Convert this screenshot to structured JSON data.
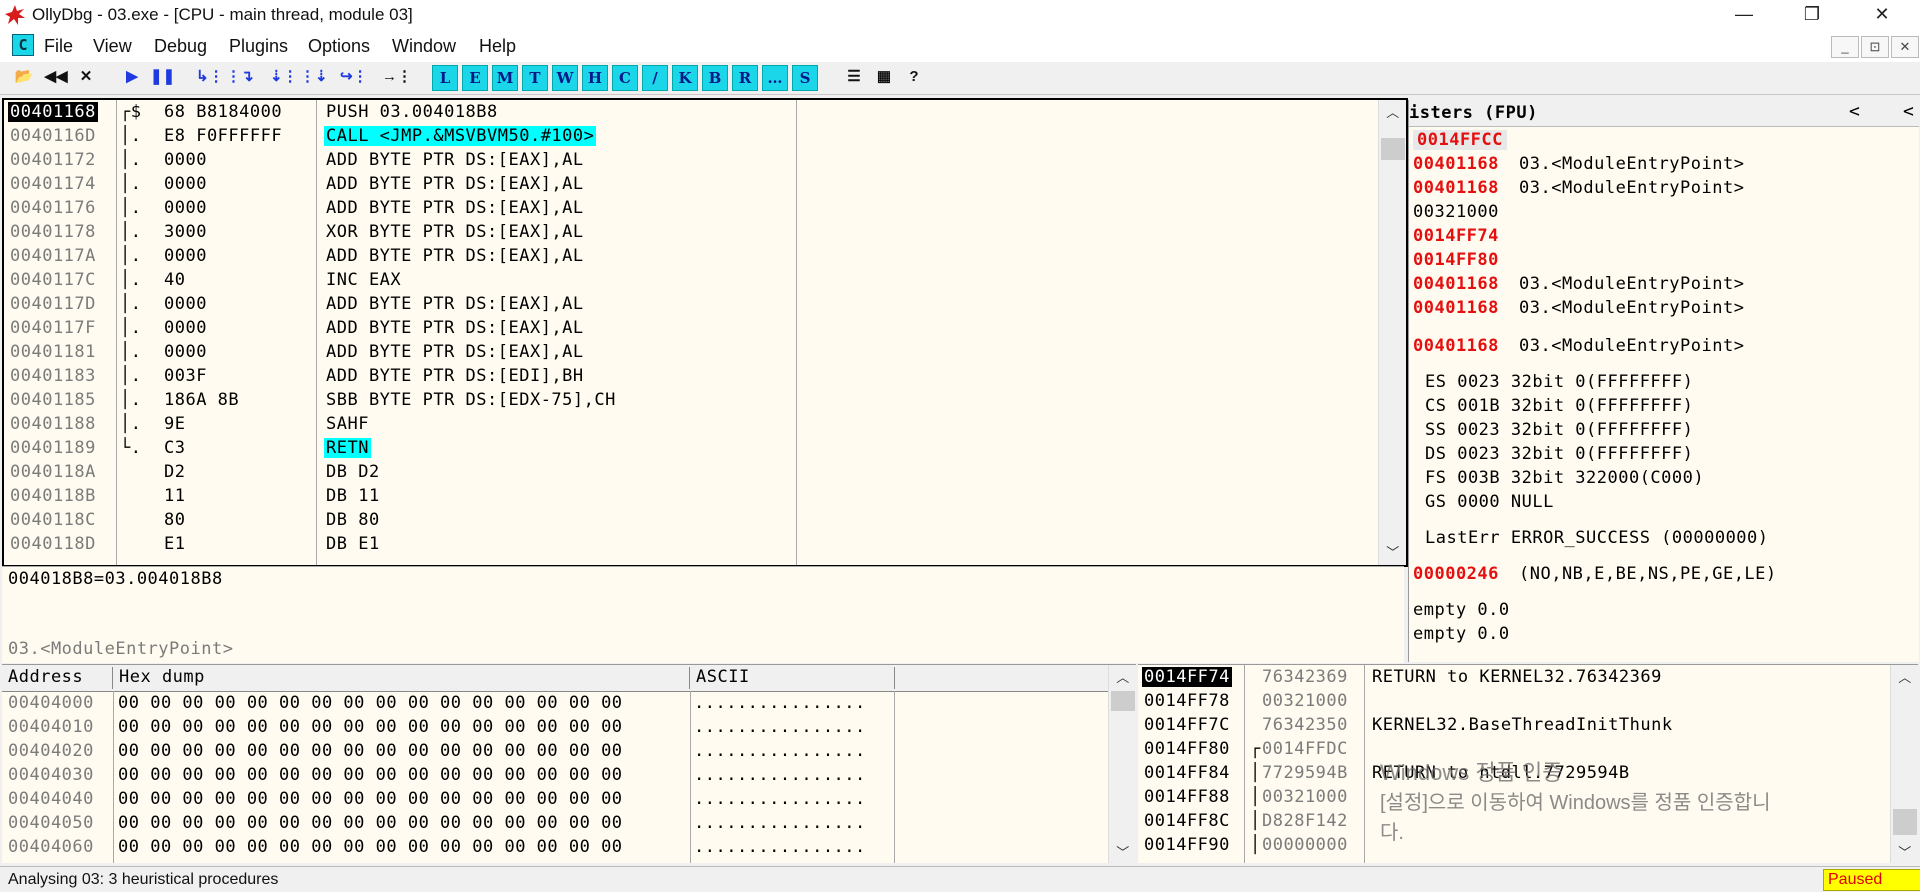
{
  "window": {
    "title": "OllyDbg - 03.exe - [CPU - main thread, module 03]",
    "controls": [
      "—",
      "❐",
      "✕"
    ]
  },
  "menu": {
    "sys_icon": "C",
    "items": [
      "File",
      "View",
      "Debug",
      "Plugins",
      "Options",
      "Window",
      "Help"
    ],
    "mdi_controls": [
      "_",
      "⊡",
      "✕"
    ]
  },
  "toolbar": {
    "buttons": [
      {
        "icon": "open-folder-icon",
        "glyph": "📂",
        "style": "dark"
      },
      {
        "icon": "rewind-icon",
        "glyph": "◀◀",
        "style": "dark"
      },
      {
        "icon": "close-icon",
        "glyph": "✕",
        "style": "dark"
      },
      {
        "icon": "run-icon",
        "glyph": "▶",
        "style": "blue"
      },
      {
        "icon": "pause-icon",
        "glyph": "❚❚",
        "style": "blue"
      },
      {
        "icon": "step-into-icon",
        "glyph": "↳⋮",
        "style": "blue"
      },
      {
        "icon": "step-over-icon",
        "glyph": "⋮↴",
        "style": "blue"
      },
      {
        "icon": "trace-into-icon",
        "glyph": "⇣⋮",
        "style": "blue"
      },
      {
        "icon": "trace-over-icon",
        "glyph": "⋮⇣",
        "style": "blue"
      },
      {
        "icon": "execute-till-return-icon",
        "glyph": "↪⋮",
        "style": "blue"
      },
      {
        "icon": "goto-icon",
        "glyph": "→⋮",
        "style": "dark"
      },
      {
        "icon": "log-window-icon",
        "glyph": "L",
        "style": "letter"
      },
      {
        "icon": "executable-modules-icon",
        "glyph": "E",
        "style": "letter"
      },
      {
        "icon": "memory-map-icon",
        "glyph": "M",
        "style": "letter"
      },
      {
        "icon": "threads-icon",
        "glyph": "T",
        "style": "letter"
      },
      {
        "icon": "windows-icon",
        "glyph": "W",
        "style": "letter"
      },
      {
        "icon": "handles-icon",
        "glyph": "H",
        "style": "letter"
      },
      {
        "icon": "cpu-icon",
        "glyph": "C",
        "style": "letter"
      },
      {
        "icon": "patches-icon",
        "glyph": "/",
        "style": "letter"
      },
      {
        "icon": "call-stack-icon",
        "glyph": "K",
        "style": "letter"
      },
      {
        "icon": "breakpoints-icon",
        "glyph": "B",
        "style": "letter"
      },
      {
        "icon": "references-icon",
        "glyph": "R",
        "style": "letter"
      },
      {
        "icon": "run-trace-icon",
        "glyph": "…",
        "style": "letter"
      },
      {
        "icon": "source-icon",
        "glyph": "S",
        "style": "letter"
      },
      {
        "icon": "list-icon",
        "glyph": "☰",
        "style": "dark"
      },
      {
        "icon": "appearance-icon",
        "glyph": "▦",
        "style": "dark"
      },
      {
        "icon": "help-icon",
        "glyph": "?",
        "style": "dark"
      }
    ]
  },
  "disasm": {
    "rows": [
      {
        "addr": "00401168",
        "brk": "┌$",
        "hex": "68 B8184000",
        "asm": "PUSH 03.004018B8",
        "selected": true,
        "hl": false
      },
      {
        "addr": "0040116D",
        "brk": "│.",
        "hex": "E8 F0FFFFFF",
        "asm": "CALL <JMP.&MSVBVM50.#100>",
        "selected": false,
        "hl": true
      },
      {
        "addr": "00401172",
        "brk": "│.",
        "hex": "0000",
        "asm": "ADD BYTE PTR DS:[EAX],AL",
        "selected": false,
        "hl": false
      },
      {
        "addr": "00401174",
        "brk": "│.",
        "hex": "0000",
        "asm": "ADD BYTE PTR DS:[EAX],AL",
        "selected": false,
        "hl": false
      },
      {
        "addr": "00401176",
        "brk": "│.",
        "hex": "0000",
        "asm": "ADD BYTE PTR DS:[EAX],AL",
        "selected": false,
        "hl": false
      },
      {
        "addr": "00401178",
        "brk": "│.",
        "hex": "3000",
        "asm": "XOR BYTE PTR DS:[EAX],AL",
        "selected": false,
        "hl": false
      },
      {
        "addr": "0040117A",
        "brk": "│.",
        "hex": "0000",
        "asm": "ADD BYTE PTR DS:[EAX],AL",
        "selected": false,
        "hl": false
      },
      {
        "addr": "0040117C",
        "brk": "│.",
        "hex": "40",
        "asm": "INC EAX",
        "selected": false,
        "hl": false
      },
      {
        "addr": "0040117D",
        "brk": "│.",
        "hex": "0000",
        "asm": "ADD BYTE PTR DS:[EAX],AL",
        "selected": false,
        "hl": false
      },
      {
        "addr": "0040117F",
        "brk": "│.",
        "hex": "0000",
        "asm": "ADD BYTE PTR DS:[EAX],AL",
        "selected": false,
        "hl": false
      },
      {
        "addr": "00401181",
        "brk": "│.",
        "hex": "0000",
        "asm": "ADD BYTE PTR DS:[EAX],AL",
        "selected": false,
        "hl": false
      },
      {
        "addr": "00401183",
        "brk": "│.",
        "hex": "003F",
        "asm": "ADD BYTE PTR DS:[EDI],BH",
        "selected": false,
        "hl": false
      },
      {
        "addr": "00401185",
        "brk": "│.",
        "hex": "186A 8B",
        "asm": "SBB BYTE PTR DS:[EDX-75],CH",
        "selected": false,
        "hl": false
      },
      {
        "addr": "00401188",
        "brk": "│.",
        "hex": "9E",
        "asm": "SAHF",
        "selected": false,
        "hl": false
      },
      {
        "addr": "00401189",
        "brk": "└.",
        "hex": "C3",
        "asm": "RETN",
        "selected": false,
        "hl": true
      },
      {
        "addr": "0040118A",
        "brk": "",
        "hex": "D2",
        "asm": "DB D2",
        "selected": false,
        "hl": false
      },
      {
        "addr": "0040118B",
        "brk": "",
        "hex": "11",
        "asm": "DB 11",
        "selected": false,
        "hl": false
      },
      {
        "addr": "0040118C",
        "brk": "",
        "hex": "80",
        "asm": "DB 80",
        "selected": false,
        "hl": false
      },
      {
        "addr": "0040118D",
        "brk": "",
        "hex": "E1",
        "asm": "DB E1",
        "selected": false,
        "hl": false
      }
    ]
  },
  "info": {
    "line1": "004018B8=03.004018B8",
    "line2": "03.<ModuleEntryPoint>"
  },
  "registers": {
    "header": "isters (FPU)",
    "header_controls": [
      "<",
      "<"
    ],
    "rows": [
      {
        "v": "0014FFCC",
        "c": "",
        "red": true,
        "box": true
      },
      {
        "v": "00401168",
        "c": "03.<ModuleEntryPoint>",
        "red": true
      },
      {
        "v": "00401168",
        "c": "03.<ModuleEntryPoint>",
        "red": true
      },
      {
        "v": "00321000",
        "c": "",
        "red": false
      },
      {
        "v": "0014FF74",
        "c": "",
        "red": true
      },
      {
        "v": "0014FF80",
        "c": "",
        "red": true
      },
      {
        "v": "00401168",
        "c": "03.<ModuleEntryPoint>",
        "red": true
      },
      {
        "v": "00401168",
        "c": "03.<ModuleEntryPoint>",
        "red": true
      }
    ],
    "eip": {
      "v": "00401168",
      "c": "03.<ModuleEntryPoint>"
    },
    "segments": [
      "ES 0023 32bit 0(FFFFFFFF)",
      "CS 001B 32bit 0(FFFFFFFF)",
      "SS 0023 32bit 0(FFFFFFFF)",
      "DS 0023 32bit 0(FFFFFFFF)",
      "FS 003B 32bit 322000(C000)",
      "GS 0000 NULL"
    ],
    "lasterr": "LastErr ERROR_SUCCESS (00000000)",
    "efl": {
      "v": "00000246",
      "c": "(NO,NB,E,BE,NS,PE,GE,LE)"
    },
    "fpu": [
      "empty 0.0",
      "empty 0.0"
    ]
  },
  "dump": {
    "headers": [
      "Address",
      "Hex dump",
      "ASCII"
    ],
    "rows": [
      {
        "addr": "00404000",
        "hex": "00 00 00 00 00 00 00 00 00 00 00 00 00 00 00 00",
        "ascii": "................"
      },
      {
        "addr": "00404010",
        "hex": "00 00 00 00 00 00 00 00 00 00 00 00 00 00 00 00",
        "ascii": "................"
      },
      {
        "addr": "00404020",
        "hex": "00 00 00 00 00 00 00 00 00 00 00 00 00 00 00 00",
        "ascii": "................"
      },
      {
        "addr": "00404030",
        "hex": "00 00 00 00 00 00 00 00 00 00 00 00 00 00 00 00",
        "ascii": "................"
      },
      {
        "addr": "00404040",
        "hex": "00 00 00 00 00 00 00 00 00 00 00 00 00 00 00 00",
        "ascii": "................"
      },
      {
        "addr": "00404050",
        "hex": "00 00 00 00 00 00 00 00 00 00 00 00 00 00 00 00",
        "ascii": "................"
      },
      {
        "addr": "00404060",
        "hex": "00 00 00 00 00 00 00 00 00 00 00 00 00 00 00 00",
        "ascii": "................"
      }
    ]
  },
  "stack": {
    "rows": [
      {
        "addr": "0014FF74",
        "val": "76342369",
        "comment": "RETURN to KERNEL32.76342369",
        "selected": true,
        "brk": ""
      },
      {
        "addr": "0014FF78",
        "val": "00321000",
        "comment": "",
        "selected": false,
        "brk": ""
      },
      {
        "addr": "0014FF7C",
        "val": "76342350",
        "comment": "KERNEL32.BaseThreadInitThunk",
        "selected": false,
        "brk": ""
      },
      {
        "addr": "0014FF80",
        "val": "0014FFDC",
        "comment": "",
        "selected": false,
        "brk": "┌"
      },
      {
        "addr": "0014FF84",
        "val": "7729594B",
        "comment": "RETURN to ntdll.7729594B",
        "selected": false,
        "brk": "│"
      },
      {
        "addr": "0014FF88",
        "val": "00321000",
        "comment": "",
        "selected": false,
        "brk": "│"
      },
      {
        "addr": "0014FF8C",
        "val": "D828F142",
        "comment": "",
        "selected": false,
        "brk": "│"
      },
      {
        "addr": "0014FF90",
        "val": "00000000",
        "comment": "",
        "selected": false,
        "brk": "│"
      }
    ]
  },
  "watermark": {
    "line1": "Windows 정품 인증",
    "line2": "[설정]으로 이동하여 Windows를 정품 인증합니",
    "line3": "다."
  },
  "status": {
    "message": "Analysing 03: 3 heuristical procedures",
    "state": "Paused"
  },
  "colors": {
    "pane_bg": "#fffbf0",
    "highlight_cyan": "#00ffff",
    "register_red": "#e41010",
    "paused_bg": "#ffff00"
  }
}
